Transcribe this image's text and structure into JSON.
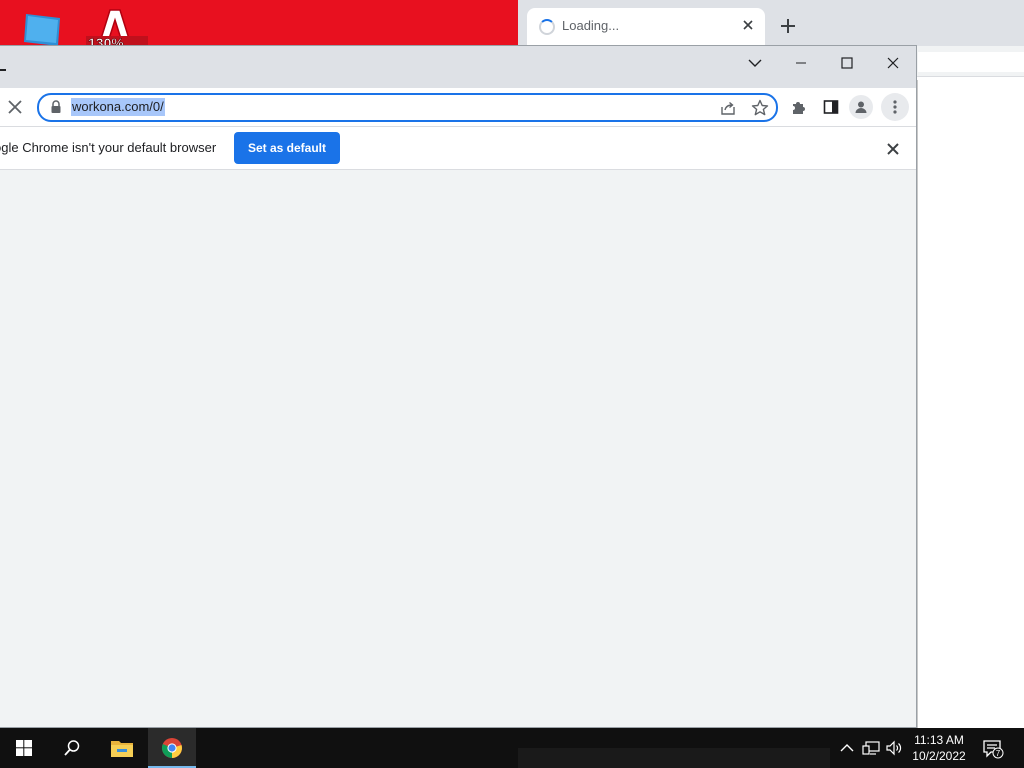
{
  "background_tab": {
    "title": "Loading...",
    "new_tab_label": "+"
  },
  "address_bar": {
    "url": "workona.com/0/"
  },
  "infobar": {
    "message": "ogle Chrome isn't your default browser",
    "button_label": "Set as default"
  },
  "taskbar": {
    "time": "11:13 AM",
    "date": "10/2/2022",
    "notification_count": "7"
  },
  "icons": {
    "background_tab": [
      "loading-spinner-icon",
      "close-icon",
      "plus-icon"
    ],
    "window": [
      "chevron-down-icon",
      "minimize-icon",
      "maximize-icon",
      "close-icon"
    ],
    "toolbar": [
      "stop-icon",
      "lock-icon",
      "share-icon",
      "star-icon",
      "extensions-icon",
      "side-panel-icon",
      "profile-icon",
      "more-vert-icon"
    ],
    "taskbar": [
      "windows-start-icon",
      "search-icon",
      "file-explorer-icon",
      "chrome-icon",
      "chevron-up-icon",
      "network-icon",
      "volume-icon",
      "notification-icon"
    ]
  },
  "colors": {
    "accent": "#1a73e8",
    "url_selection": "#a8c7fa",
    "desktop_red": "#e8101f",
    "taskbar": "#101010"
  }
}
